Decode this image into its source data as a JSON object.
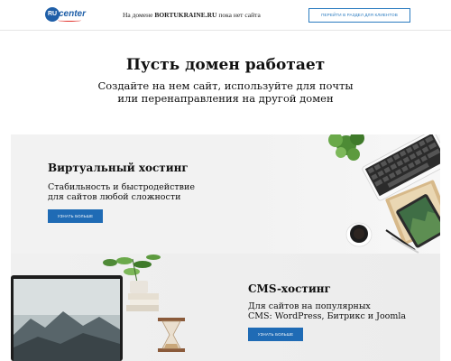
{
  "header": {
    "logo": {
      "badge": "RU",
      "text": "center"
    },
    "notice_prefix": "На домене ",
    "notice_domain": "BORTUKRAINE.RU",
    "notice_suffix": " пока нет сайта",
    "client_button": "ПЕРЕЙТИ В РАЗДЕЛ ДЛЯ КЛИЕНТОВ"
  },
  "hero": {
    "title": "Пусть домен работает",
    "subtitle_line1": "Создайте на нем сайт, используйте для почты",
    "subtitle_line2": "или перенаправления на другой домен"
  },
  "panels": [
    {
      "title": "Виртуальный хостинг",
      "line1": "Стабильность и быстродействие",
      "line2": "для сайтов любой сложности",
      "button": "УЗНАТЬ БОЛЬШЕ"
    },
    {
      "title": "CMS-хостинг",
      "line1": "Для сайтов на популярных",
      "line2": "CMS: WordPress, Битрикс и Joomla",
      "button": "УЗНАТЬ БОЛЬШЕ"
    }
  ],
  "colors": {
    "brand_blue": "#1f5fa8",
    "button_blue": "#1f6bb5",
    "logo_red": "#e2312b"
  }
}
